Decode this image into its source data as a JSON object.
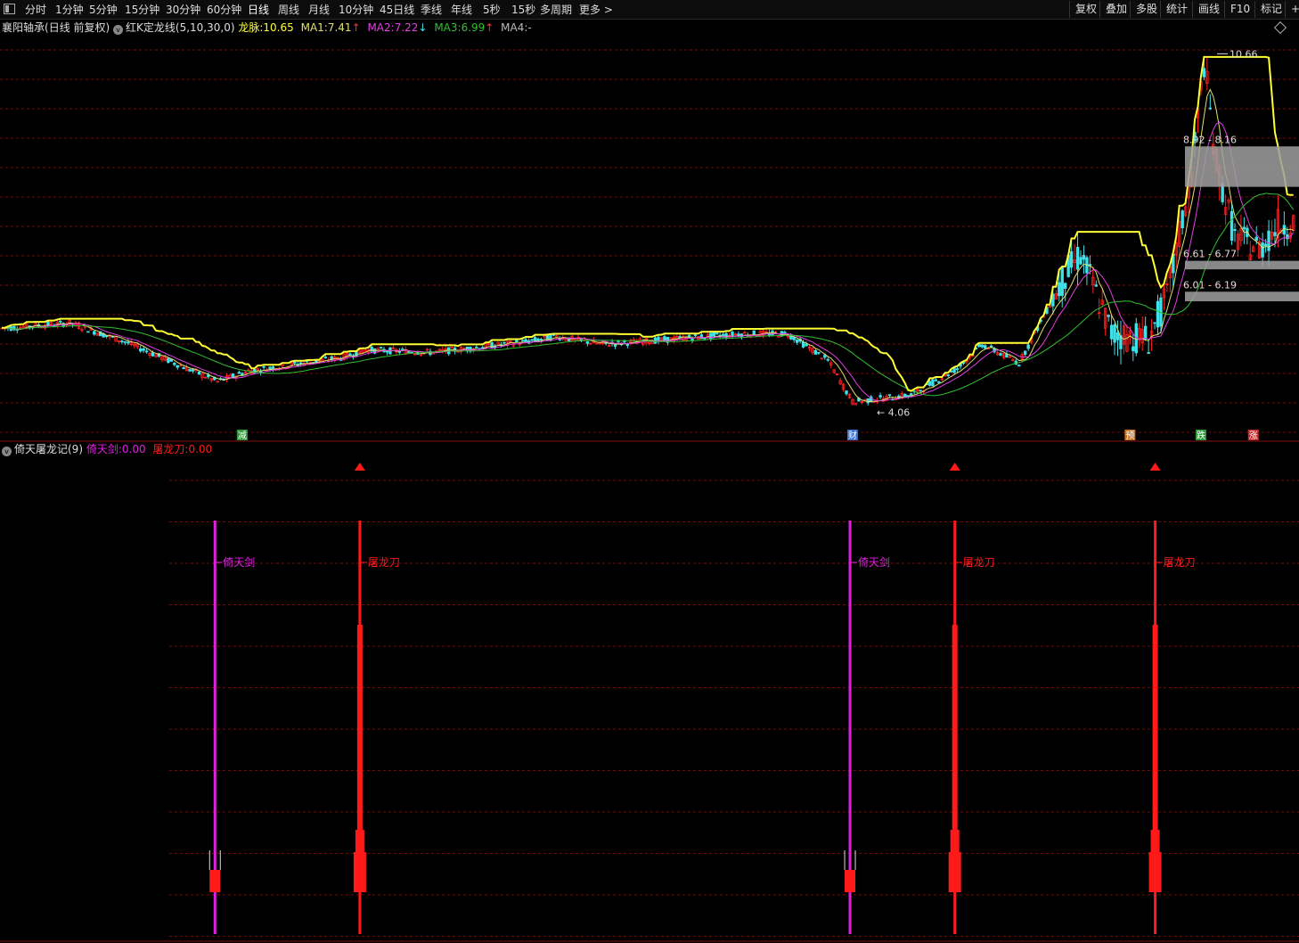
{
  "toolbar": {
    "periods": [
      "分时",
      "1分钟",
      "5分钟",
      "15分钟",
      "30分钟",
      "60分钟",
      "日线",
      "周线",
      "月线",
      "10分钟",
      "45日线",
      "季线",
      "年线",
      "5秒",
      "15秒",
      "多周期"
    ],
    "active_period": "日线",
    "more": "更多 >",
    "right_buttons": [
      "复权",
      "叠加",
      "多股",
      "统计",
      "画线",
      "F10",
      "标记",
      "+自"
    ]
  },
  "main_legend": {
    "stock_name": "襄阳轴承",
    "mode": "(日线 前复权)",
    "indicator_name": "红K定龙线(5,10,30,0)",
    "longmai_label": "龙脉:",
    "longmai_value": "10.65",
    "ma1_label": "MA1:",
    "ma1_value": "7.41",
    "ma1_dir": "↑",
    "ma2_label": "MA2:",
    "ma2_value": "7.22",
    "ma2_dir": "↓",
    "ma3_label": "MA3:",
    "ma3_value": "6.99",
    "ma3_dir": "↑",
    "ma4_label": "MA4:",
    "ma4_value": "-"
  },
  "sub_legend": {
    "indicator_name": "倚天屠龙记(9)",
    "sword_label": "倚天剑:",
    "sword_value": "0.00",
    "blade_label": "屠龙刀:",
    "blade_value": "0.00"
  },
  "price_annotations": {
    "high": "10.66",
    "low": "4.06",
    "zones": [
      {
        "label": "8.92 - 8.16",
        "low": 8.16,
        "high": 8.92
      },
      {
        "label": "6.61 - 6.77",
        "low": 6.61,
        "high": 6.77
      },
      {
        "label": "6.01 - 6.19",
        "low": 6.01,
        "high": 6.19
      }
    ]
  },
  "event_tags": [
    {
      "text": "减",
      "bar": 78,
      "color": "#2e9a3a"
    },
    {
      "text": "财",
      "bar": 276,
      "color": "#3a6ec8"
    },
    {
      "text": "预",
      "bar": 366,
      "color": "#c8701e"
    },
    {
      "text": "跌",
      "bar": 389,
      "color": "#2e9a3a"
    },
    {
      "text": "涨",
      "bar": 406,
      "color": "#c82828"
    }
  ],
  "signals": [
    {
      "type": "sword",
      "label": "倚天剑",
      "bar": 68
    },
    {
      "type": "blade",
      "label": "屠龙刀",
      "bar": 115
    },
    {
      "type": "sword",
      "label": "倚天剑",
      "bar": 274
    },
    {
      "type": "blade",
      "label": "屠龙刀",
      "bar": 308
    },
    {
      "type": "blade",
      "label": "屠龙刀",
      "bar": 373
    }
  ],
  "colors": {
    "up": "#ff2020",
    "down": "#40e0e8",
    "longmai": "#ffff33",
    "ma1": "#e0e070",
    "ma2": "#e040e0",
    "ma3": "#30c030",
    "grid": "#6a0f0f",
    "sword": "#e020e0",
    "blade": "#ff1a1a",
    "zone": "#a0a0a0"
  }
}
